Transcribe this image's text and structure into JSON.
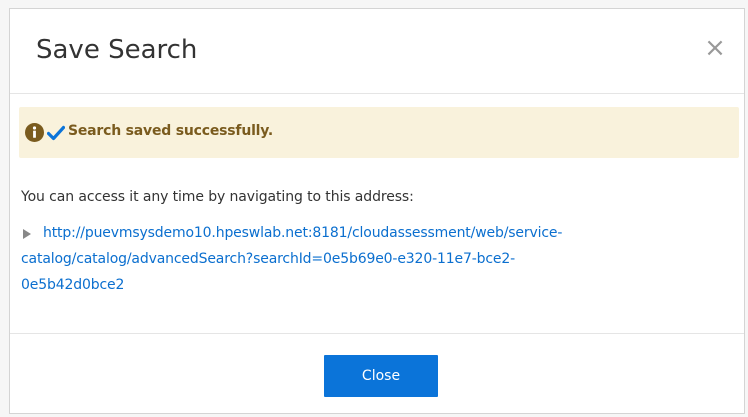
{
  "dialog": {
    "title": "Save Search",
    "close_icon": "close-x-icon"
  },
  "alert": {
    "info_icon": "info-icon",
    "check_icon": "checkmark-icon",
    "message": "Search saved successfully.",
    "colors": {
      "background": "#f9f2dc",
      "info_icon": "#7a5b1e",
      "check_icon": "#0b74d9",
      "text": "#7a5b1e"
    }
  },
  "body": {
    "instruction": "You can access it any time by navigating to this address:",
    "arrow_icon": "caret-right-icon",
    "link_line1": "http://puevmsysdemo10.hpeswlab.net:8181/cloudassessment/web/service-",
    "link_line2": "catalog/catalog/advancedSearch?searchId=0e5b69e0-e320-11e7-bce2-",
    "link_line3": "0e5b42d0bce2",
    "link_color": "#0b6fcf"
  },
  "footer": {
    "close_label": "Close",
    "button_color": "#0b74d9"
  }
}
